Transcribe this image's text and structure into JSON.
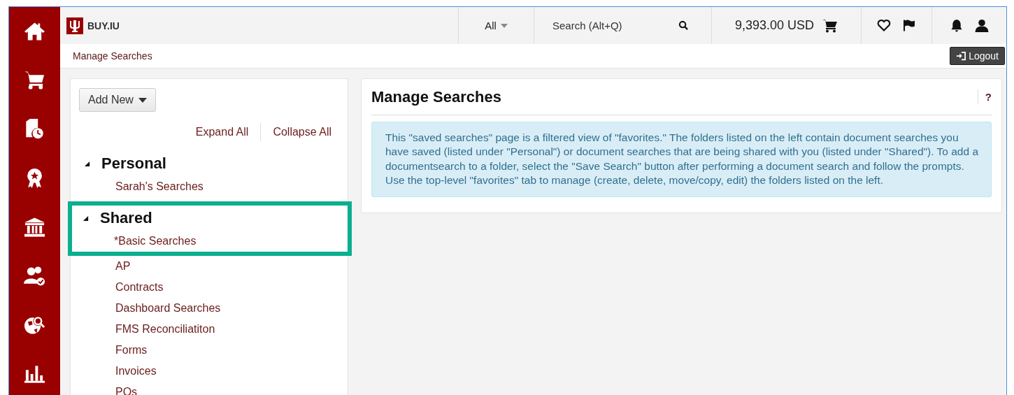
{
  "header": {
    "logo_text": "BUY.IU",
    "scope": "All",
    "search": {
      "placeholder": "Search (Alt+Q)"
    },
    "cart_total": "9,393.00 USD"
  },
  "breadcrumb": "Manage Searches",
  "logout": "Logout",
  "folders": {
    "add_button": "Add New",
    "expand_all": "Expand All",
    "collapse_all": "Collapse All",
    "groups": [
      {
        "label": "Personal",
        "expanded": true,
        "highlighted": false,
        "children": [
          {
            "label": "Sarah's Searches"
          }
        ]
      },
      {
        "label": "Shared",
        "expanded": true,
        "highlighted": true,
        "children": [
          {
            "label": "*Basic Searches"
          },
          {
            "label": "AP"
          },
          {
            "label": "Contracts"
          },
          {
            "label": "Dashboard Searches"
          },
          {
            "label": "FMS Reconciliatiton"
          },
          {
            "label": "Forms"
          },
          {
            "label": "Invoices"
          },
          {
            "label": "POs"
          }
        ]
      }
    ]
  },
  "main": {
    "title": "Manage Searches",
    "help": "?",
    "info": "This \"saved searches\" page is a filtered view of \"favorites.\" The folders listed on the left contain document searches you have saved (listed under \"Personal\") or document searches that are being shared with you (listed under \"Shared\"). To add a documentsearch to a folder, select the \"Save Search\" button after performing a document search and follow the prompts. Use the top-level \"favorites\" tab to manage (create, delete, move/copy, edit) the folders listed on the left."
  }
}
